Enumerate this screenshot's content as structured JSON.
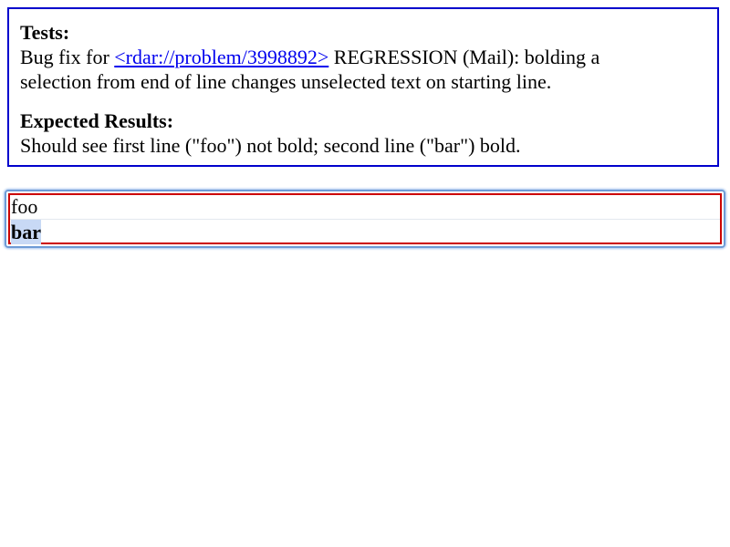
{
  "explanation": {
    "tests_heading": "Tests:",
    "tests_text_before": "Bug fix for ",
    "tests_link": "<rdar://problem/3998892>",
    "tests_text_after": " REGRESSION (Mail): bolding a",
    "tests_text_line2": "selection from end of line changes unselected text on starting line.",
    "expected_heading": "Expected Results:",
    "expected_text": "Should see first line (\"foo\") not bold; second line (\"bar\") bold."
  },
  "test_area": {
    "line1": "foo",
    "line2": "bar",
    "line2_bold": true,
    "line2_selected": true
  },
  "colors": {
    "explanation_border": "#0000cc",
    "link": "#0000ee",
    "test_outer_border": "#6e9bd6",
    "test_inner_border": "#cc0000",
    "selection": "#c8d9f5"
  }
}
